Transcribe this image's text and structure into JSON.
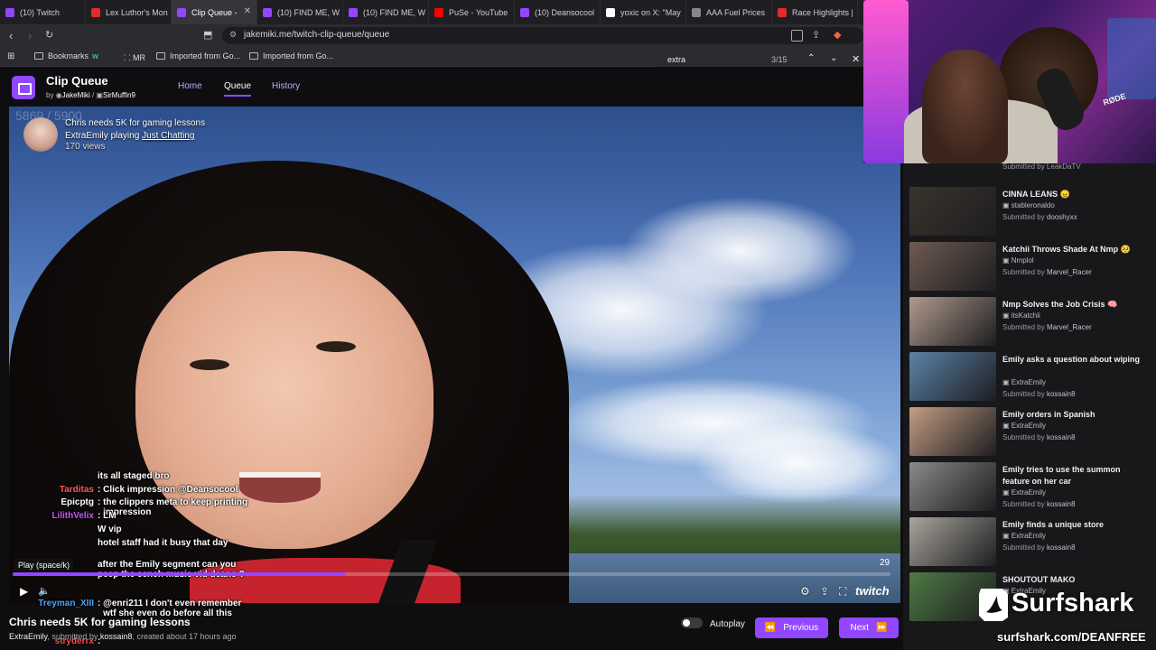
{
  "browser": {
    "tabs": [
      {
        "label": "(10) Twitch",
        "color": "#9147ff",
        "active": false
      },
      {
        "label": "Lex Luthor's Mon",
        "color": "#e02b2b",
        "active": false
      },
      {
        "label": "Clip Queue -",
        "color": "#9147ff",
        "active": true
      },
      {
        "label": "(10) FIND ME, W",
        "color": "#9147ff",
        "active": false
      },
      {
        "label": "(10) FIND ME, W",
        "color": "#9147ff",
        "active": false
      },
      {
        "label": "PuSe - YouTube",
        "color": "#ff0000",
        "active": false
      },
      {
        "label": "(10) Deansocool",
        "color": "#9147ff",
        "active": false
      },
      {
        "label": "yoxic on X: \"May",
        "color": "#ffffff",
        "active": false
      },
      {
        "label": "AAA Fuel Prices",
        "color": "#888888",
        "active": false
      },
      {
        "label": "Race Highlights |",
        "color": "#e02b2b",
        "active": false
      }
    ],
    "url": "jakemiki.me/twitch-clip-queue/queue",
    "bookmarks": [
      "Bookmarks",
      "w",
      "MR",
      "Imported from Go...",
      "Imported from Go..."
    ],
    "find": {
      "query": "extra",
      "count": "3/15"
    }
  },
  "app": {
    "title": "Clip Queue",
    "by_prefix": "by",
    "authors": [
      "JakeMiki",
      "SirMuffin9"
    ],
    "nav": [
      "Home",
      "Queue",
      "History"
    ],
    "active_nav": "Queue"
  },
  "clip": {
    "count": "5869 / 5900",
    "title": "Chris needs 5K for gaming lessons",
    "channel": "ExtraEmily",
    "playing_prefix": "playing",
    "category": "Just Chatting",
    "views": "170 views",
    "timecode": "29",
    "progress": 0.38,
    "tooltip": "Play (space/k)",
    "brand": "twitch",
    "submitted_prefix": "submitted by",
    "submitter": "kossain8",
    "created": "created about 17 hours ago"
  },
  "chat": [
    {
      "name": "",
      "color": "#ff4d4d",
      "msg": "its all staged bro"
    },
    {
      "name": "Tarditas",
      "color": "#ff5a5a",
      "msg": "Click impression @Deansocool"
    },
    {
      "name": "Epicptg",
      "color": "#ffffff",
      "msg": "the clippers meta to keep printing impression"
    },
    {
      "name": "LilithVelix",
      "color": "#c05af0",
      "msg": "LM"
    },
    {
      "name": "",
      "color": "#ffffff",
      "msg": "W vip"
    },
    {
      "name": "",
      "color": "#ff4d4d",
      "msg": "hotel staff had it busy that day"
    },
    {
      "name": "",
      "color": "#ffffff",
      "msg": "after the Emily segment can you peep the cench music vid deano ?"
    },
    {
      "name": "Treyman_XIII",
      "color": "#4aa3ff",
      "msg": "@enri211 I don't even remember wtf she even do before all this"
    },
    {
      "name": "stryderrx",
      "color": "#ff4d4d",
      "msg": ""
    }
  ],
  "controls": {
    "autoplay_label": "Autoplay",
    "previous_label": "Previous",
    "next_label": "Next"
  },
  "sidebar": {
    "partial_submitter": "Submitted by LeakDaTV",
    "submitted_prefix": "Submitted by",
    "items": [
      {
        "title": "CINNA LEANS 😠",
        "channel": "stableronaldo",
        "submitter": "dooshyxx",
        "thumb": "#3b342d"
      },
      {
        "title": "Katchii Throws Shade At Nmp 🥺",
        "channel": "Nmplol",
        "submitter": "Marvel_Racer",
        "thumb": "#6e5a52"
      },
      {
        "title": "Nmp Solves the Job Crisis 🧠",
        "channel": "itsKatchii",
        "submitter": "Marvel_Racer",
        "thumb": "#b09a8c"
      },
      {
        "title": "Emily asks a question about wiping",
        "channel": "ExtraEmily",
        "submitter": "kossain8",
        "thumb": "#5b83a8"
      },
      {
        "title": "Emily orders in Spanish",
        "channel": "ExtraEmily",
        "submitter": "kossain8",
        "thumb": "#c49e84"
      },
      {
        "title": "Emily tries to use the summon feature on her car",
        "channel": "ExtraEmily",
        "submitter": "kossain8",
        "thumb": "#8a8a88"
      },
      {
        "title": "Emily finds a unique store",
        "channel": "ExtraEmily",
        "submitter": "kossain8",
        "thumb": "#a9a59c"
      },
      {
        "title": "SHOUTOUT MAKO",
        "channel": "ExtraEmily",
        "submitter": "",
        "thumb": "#4f7a45"
      }
    ]
  },
  "webcam": {
    "mic_brand": "RØDE"
  },
  "sponsor": {
    "name": "Surfshark",
    "url": "surfshark.com/DEANFREE"
  }
}
